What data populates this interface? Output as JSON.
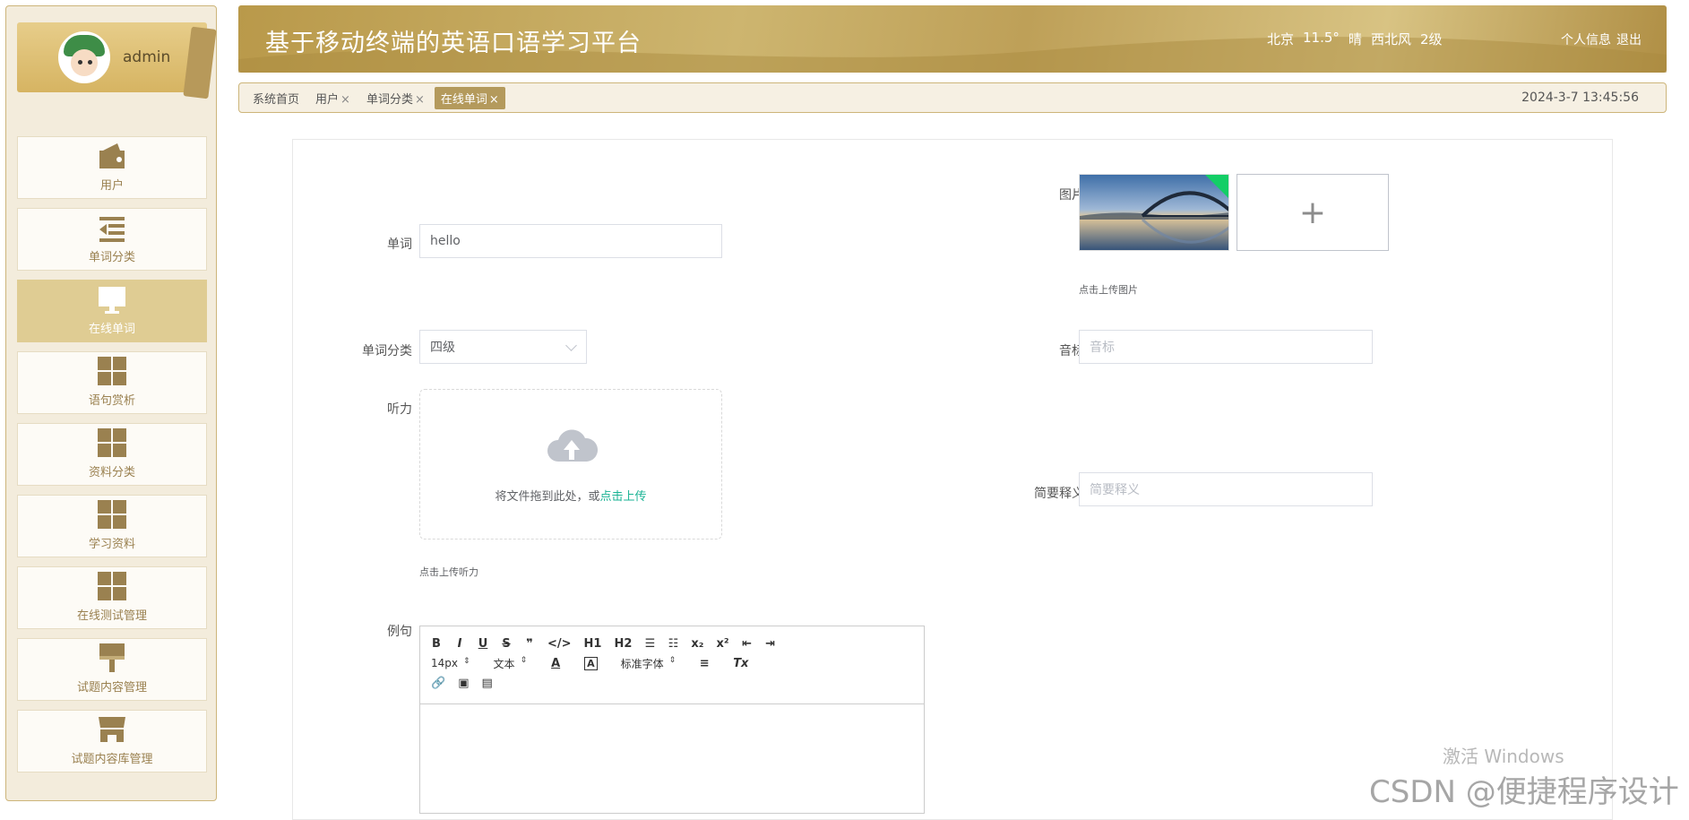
{
  "sidebar": {
    "user": {
      "name": "admin"
    },
    "items": [
      {
        "label": "用户",
        "icon": "wallet-icon"
      },
      {
        "label": "单词分类",
        "icon": "list-indent-icon"
      },
      {
        "label": "在线单词",
        "icon": "monitor-icon",
        "active": true
      },
      {
        "label": "语句赏析",
        "icon": "grid-icon"
      },
      {
        "label": "资料分类",
        "icon": "grid-icon"
      },
      {
        "label": "学习资料",
        "icon": "grid-icon"
      },
      {
        "label": "在线测试管理",
        "icon": "grid-icon"
      },
      {
        "label": "试题内容管理",
        "icon": "paint-roller-icon"
      },
      {
        "label": "试题内容库管理",
        "icon": "store-icon"
      }
    ]
  },
  "header": {
    "title": "基于移动终端的英语口语学习平台",
    "weather": {
      "city": "北京",
      "temp": "11.5°",
      "condition": "晴",
      "wind": "西北风",
      "level": "2级"
    },
    "links": {
      "profile": "个人信息",
      "logout": "退出"
    }
  },
  "tabs": {
    "items": [
      {
        "label": "系统首页",
        "closable": false
      },
      {
        "label": "用户",
        "closable": true
      },
      {
        "label": "单词分类",
        "closable": true
      },
      {
        "label": "在线单词",
        "closable": true,
        "active": true
      }
    ],
    "close_glyph": "×",
    "datetime": "2024-3-7 13:45:56"
  },
  "form": {
    "word": {
      "label": "单词",
      "value": "hello"
    },
    "image": {
      "label": "图片",
      "hint": "点击上传图片",
      "add_glyph": "+"
    },
    "category": {
      "label": "单词分类",
      "value": "四级"
    },
    "phonetic": {
      "label": "音标",
      "placeholder": "音标"
    },
    "listening": {
      "label": "听力",
      "drop_text": "将文件拖到此处，或",
      "upload_link": "点击上传",
      "hint": "点击上传听力"
    },
    "definition": {
      "label": "简要释义",
      "placeholder": "简要释义"
    },
    "example": {
      "label": "例句",
      "toolbar": {
        "row1": [
          "B",
          "I",
          "U",
          "S",
          "❞",
          "</>",
          "H1",
          "H2",
          "☰",
          "☷",
          "x₂",
          "x²",
          "⇤",
          "⇥"
        ],
        "font_size": "14px",
        "text_style": "文本",
        "font_family": "标准字体",
        "color_glyph": "A",
        "bg_glyph": "A",
        "align_glyph": "≡",
        "clear_glyph": "Tx",
        "row3": [
          "🔗",
          "▣",
          "▤"
        ]
      }
    }
  },
  "watermark": {
    "line1": "激活 Windows",
    "line2": "CSDN @便捷程序设计"
  },
  "colors": {
    "accent": "#b49a5c",
    "link": "#1ab394",
    "active_menu": "#dfcc93"
  }
}
